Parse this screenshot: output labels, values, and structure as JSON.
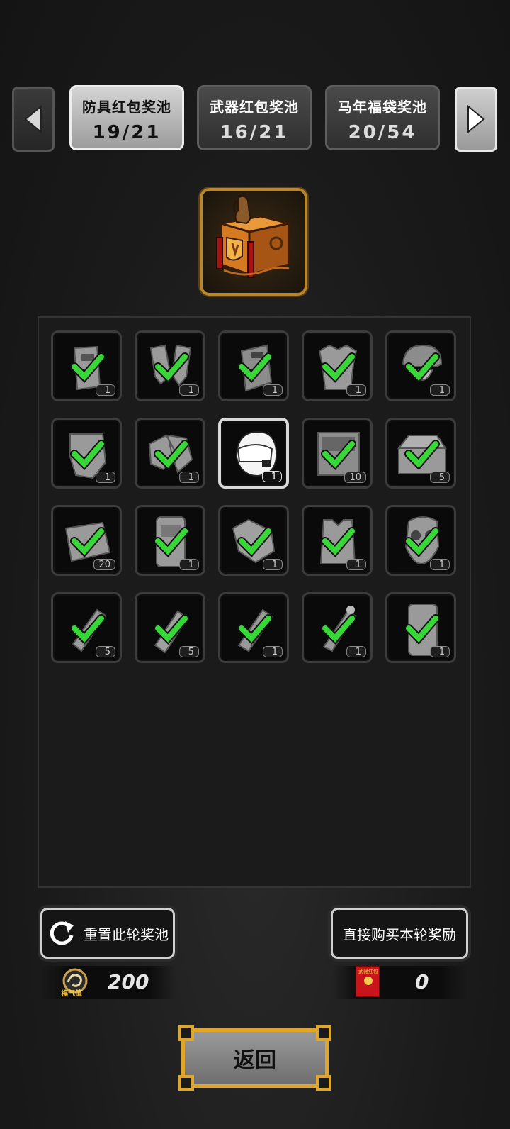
{
  "tabs": [
    {
      "title": "防具红包奖池",
      "count": "19/21"
    },
    {
      "title": "武器红包奖池",
      "count": "16/21"
    },
    {
      "title": "马年福袋奖池",
      "count": "20/54"
    }
  ],
  "grid": {
    "items": [
      {
        "icon": "riot-shield-icon",
        "qty": "1",
        "checked": true
      },
      {
        "icon": "leg-guards-icon",
        "qty": "1",
        "checked": true
      },
      {
        "icon": "tactical-shield-icon",
        "qty": "1",
        "checked": true
      },
      {
        "icon": "body-armor-icon",
        "qty": "1",
        "checked": true
      },
      {
        "icon": "tactical-helmet-icon",
        "qty": "1",
        "checked": true
      },
      {
        "icon": "armor-suit-icon",
        "qty": "1",
        "checked": true
      },
      {
        "icon": "gloves-pair-icon",
        "qty": "1",
        "checked": true
      },
      {
        "icon": "pilot-helmet-icon",
        "qty": "1",
        "checked": false
      },
      {
        "icon": "toolbox-open-icon",
        "qty": "10",
        "checked": true
      },
      {
        "icon": "tool-chest-icon",
        "qty": "5",
        "checked": true
      },
      {
        "icon": "repair-kit-icon",
        "qty": "20",
        "checked": true
      },
      {
        "icon": "backpack-icon",
        "qty": "1",
        "checked": true
      },
      {
        "icon": "glove-icon",
        "qty": "1",
        "checked": true
      },
      {
        "icon": "tactical-vest-icon",
        "qty": "1",
        "checked": true
      },
      {
        "icon": "gas-mask-icon",
        "qty": "1",
        "checked": true
      },
      {
        "icon": "flashbang-grenade-icon",
        "qty": "5",
        "checked": true
      },
      {
        "icon": "frag-grenade-icon",
        "qty": "5",
        "checked": true
      },
      {
        "icon": "smoke-grenade-icon",
        "qty": "1",
        "checked": true
      },
      {
        "icon": "stun-grenade-icon",
        "qty": "1",
        "checked": true
      },
      {
        "icon": "ballistic-shield-icon",
        "qty": "1",
        "checked": true
      }
    ]
  },
  "reset_button": {
    "label": "重置此轮奖池"
  },
  "buy_button": {
    "label": "直接购买本轮奖励"
  },
  "luck_counter": {
    "label": "福气值",
    "value": "200"
  },
  "envelope_counter": {
    "badge": "武器红包",
    "value": "0"
  },
  "back_button": {
    "label": "返回"
  },
  "colors": {
    "check": "#39d639",
    "gold": "#e0a62a",
    "panel": "#1b1b1b"
  }
}
